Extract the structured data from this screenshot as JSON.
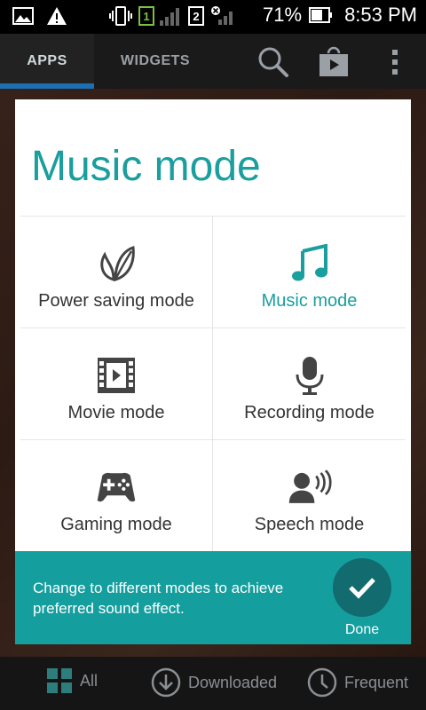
{
  "status_bar": {
    "sim1": "1",
    "sim2": "2",
    "battery": "71%",
    "time": "8:53 PM"
  },
  "header": {
    "tab_apps": "APPS",
    "tab_widgets": "WIDGETS"
  },
  "card": {
    "title": "Music mode",
    "modes": [
      {
        "label": "Power saving mode",
        "icon": "leaf-icon",
        "active": false
      },
      {
        "label": "Music mode",
        "icon": "music-note-icon",
        "active": true
      },
      {
        "label": "Movie mode",
        "icon": "film-icon",
        "active": false
      },
      {
        "label": "Recording mode",
        "icon": "microphone-icon",
        "active": false
      },
      {
        "label": "Gaming mode",
        "icon": "gamepad-icon",
        "active": false
      },
      {
        "label": "Speech mode",
        "icon": "speaking-person-icon",
        "active": false
      }
    ],
    "tip": "Change to different modes to achieve preferred sound effect.",
    "done_label": "Done"
  },
  "bottom_nav": {
    "all": "All",
    "downloaded": "Downloaded",
    "frequent": "Frequent"
  },
  "colors": {
    "accent": "#1a9e9e",
    "tip_bar": "#159e9e",
    "done_button": "#126b6e",
    "tab_underline": "#1c6fb0"
  }
}
